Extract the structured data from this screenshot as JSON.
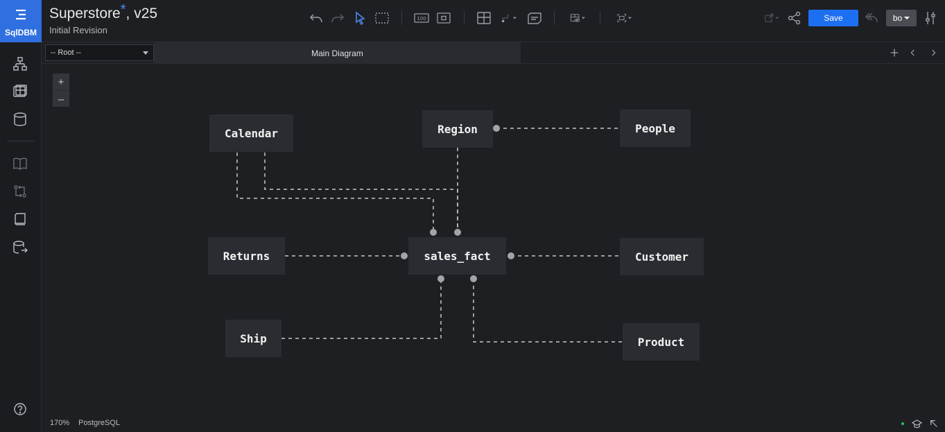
{
  "app": {
    "logo_label": "SqlDBM"
  },
  "header": {
    "project_name": "Superstore",
    "unsaved_marker": "*",
    "version": ", v25",
    "revision": "Initial Revision",
    "save_label": "Save",
    "user_label": "bo"
  },
  "subbar": {
    "root_select": "-- Root --",
    "diagram_tab": "Main Diagram"
  },
  "zoom": {
    "in": "+",
    "out": "–"
  },
  "entities": {
    "calendar": "Calendar",
    "region": "Region",
    "people": "People",
    "returns": "Returns",
    "sales_fact": "sales_fact",
    "customer": "Customer",
    "ship": "Ship",
    "product": "Product"
  },
  "footer": {
    "zoom_level": "170%",
    "database": "PostgreSQL"
  },
  "colors": {
    "accent": "#2f6fe0",
    "save": "#1d6ff2",
    "connector": "#c9c9c9",
    "entity_bg": "#2a2c31",
    "status_dot": "#22c55e"
  }
}
